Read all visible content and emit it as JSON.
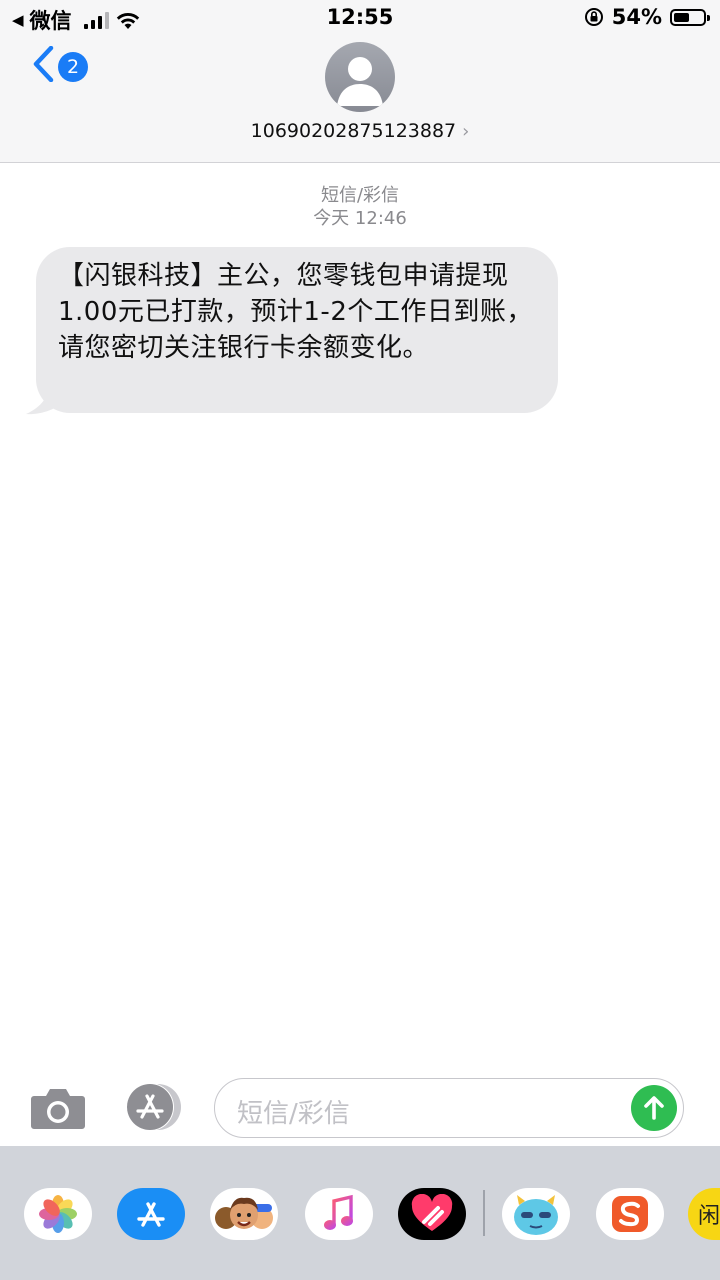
{
  "status_bar": {
    "back_app": "微信",
    "time": "12:55",
    "battery_text": "54%",
    "battery_level": 0.54
  },
  "header": {
    "back_badge": "2",
    "contact": "10690202875123887"
  },
  "thread": {
    "service": "短信/彩信",
    "timestamp": "今天 12:46",
    "messages": [
      {
        "direction": "incoming",
        "text": "【闪银科技】主公，您零钱包申请提现1.00元已打款，预计1-2个工作日到账，请您密切关注银行卡余额变化。"
      }
    ]
  },
  "composer": {
    "placeholder": "短信/彩信"
  },
  "app_drawer": {
    "apps": [
      "photos-icon",
      "app-store-icon",
      "memoji-icon",
      "music-icon",
      "digital-touch-icon",
      "cartoon-monster-sticker-icon",
      "sogou-input-icon",
      "partial-yellow-app-icon"
    ],
    "partial_app_glyph": "闲"
  },
  "colors": {
    "ios_blue": "#1a7cf6",
    "send_green": "#2fbd52",
    "bubble_gray": "#e9e9eb",
    "drawer_gray": "#d1d4da"
  }
}
